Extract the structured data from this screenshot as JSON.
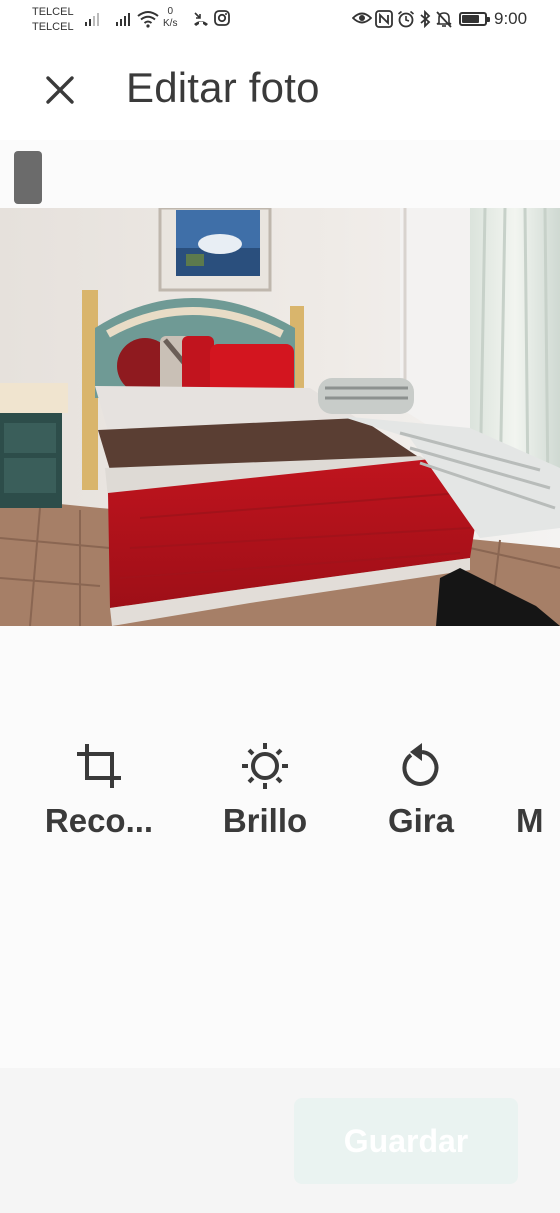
{
  "status_bar": {
    "carrier_1": "TELCEL",
    "carrier_2": "TELCEL",
    "net_speed_value": "0",
    "net_speed_unit": "K/s",
    "time": "9:00",
    "battery_level": 0.7,
    "icons": [
      "signal-icon",
      "signal-icon",
      "wifi-icon",
      "missed-call-icon",
      "instagram-icon",
      "eye-icon",
      "nfc-icon",
      "alarm-icon",
      "bluetooth-icon",
      "mute-icon",
      "battery-icon"
    ]
  },
  "header": {
    "title": "Editar foto",
    "close_icon": "close-icon"
  },
  "photo": {
    "description_icon": "photo-image"
  },
  "tools": {
    "items": [
      {
        "label": "Reco...",
        "icon": "crop-icon"
      },
      {
        "label": "Brillo",
        "icon": "brightness-icon"
      },
      {
        "label": "Gira",
        "icon": "rotate-icon"
      },
      {
        "label": "M",
        "icon": ""
      }
    ]
  },
  "footer": {
    "save_label": "Guardar",
    "save_enabled": false
  },
  "colors": {
    "background": "#fbfbfb",
    "text": "#3a3a3a",
    "save_disabled_bg": "#eaf3f1",
    "bedspread_red": "#b5121b"
  }
}
